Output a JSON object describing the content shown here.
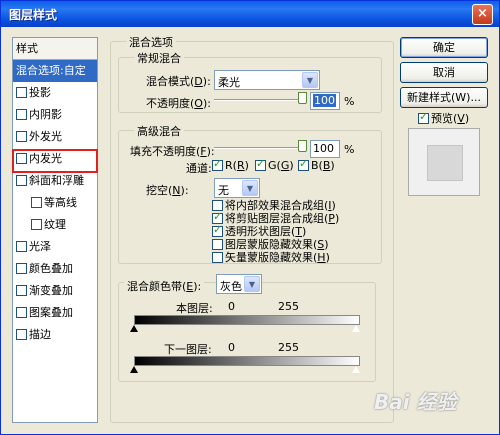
{
  "window": {
    "title": "图层样式",
    "close_glyph": "×"
  },
  "left_panel": {
    "header": "样式",
    "items": [
      {
        "label": "混合选项:自定",
        "checkbox": false,
        "selected": true
      },
      {
        "label": "投影",
        "checkbox": true,
        "checked": false
      },
      {
        "label": "内阴影",
        "checkbox": true,
        "checked": false
      },
      {
        "label": "外发光",
        "checkbox": true,
        "checked": false
      },
      {
        "label": "内发光",
        "checkbox": true,
        "checked": false
      },
      {
        "label": "斜面和浮雕",
        "checkbox": true,
        "checked": false,
        "highlighted": true
      },
      {
        "label": "等高线",
        "checkbox": true,
        "checked": false,
        "indent": true
      },
      {
        "label": "纹理",
        "checkbox": true,
        "checked": false,
        "indent": true
      },
      {
        "label": "光泽",
        "checkbox": true,
        "checked": false
      },
      {
        "label": "颜色叠加",
        "checkbox": true,
        "checked": false
      },
      {
        "label": "渐变叠加",
        "checkbox": true,
        "checked": false
      },
      {
        "label": "图案叠加",
        "checkbox": true,
        "checked": false
      },
      {
        "label": "描边",
        "checkbox": true,
        "checked": false
      }
    ]
  },
  "blend_options": {
    "group_title": "混合选项",
    "general": {
      "title": "常规混合",
      "mode_label": "混合模式(",
      "mode_key": "D",
      "mode_close": "):",
      "mode_value": "柔光",
      "opacity_label": "不透明度(",
      "opacity_key": "O",
      "opacity_close": "):",
      "opacity_value": "100",
      "opacity_unit": "%"
    },
    "advanced": {
      "title": "高级混合",
      "fill_label": "填充不透明度(",
      "fill_key": "F",
      "fill_close": "):",
      "fill_value": "100",
      "fill_unit": "%",
      "channels_label": "通道:",
      "channels": [
        {
          "label": "R(",
          "key": "R",
          "close": ")",
          "checked": true
        },
        {
          "label": "G(",
          "key": "G",
          "close": ")",
          "checked": true
        },
        {
          "label": "B(",
          "key": "B",
          "close": ")",
          "checked": true
        }
      ],
      "knockout_label": "挖空(",
      "knockout_key": "N",
      "knockout_close": "):",
      "knockout_value": "无",
      "options": [
        {
          "label": "将内部效果混合成组(",
          "key": "I",
          "close": ")",
          "checked": false
        },
        {
          "label": "将剪贴图层混合成组(",
          "key": "P",
          "close": ")",
          "checked": true
        },
        {
          "label": "透明形状图层(",
          "key": "T",
          "close": ")",
          "checked": true
        },
        {
          "label": "图层蒙版隐藏效果(",
          "key": "S",
          "close": ")",
          "checked": false
        },
        {
          "label": "矢量蒙版隐藏效果(",
          "key": "H",
          "close": ")",
          "checked": false
        }
      ]
    },
    "blend_if": {
      "label": "混合颜色带(",
      "key": "E",
      "close": "):",
      "value": "灰色",
      "this_layer_label": "本图层:",
      "this_layer_low": "0",
      "this_layer_high": "255",
      "under_layer_label": "下一图层:",
      "under_layer_low": "0",
      "under_layer_high": "255"
    }
  },
  "buttons": {
    "ok": "确定",
    "cancel": "取消",
    "new_style": "新建样式(W)...",
    "preview_label": "预览(",
    "preview_key": "V",
    "preview_close": ")",
    "preview_checked": true
  },
  "watermark": "Bai 经验"
}
